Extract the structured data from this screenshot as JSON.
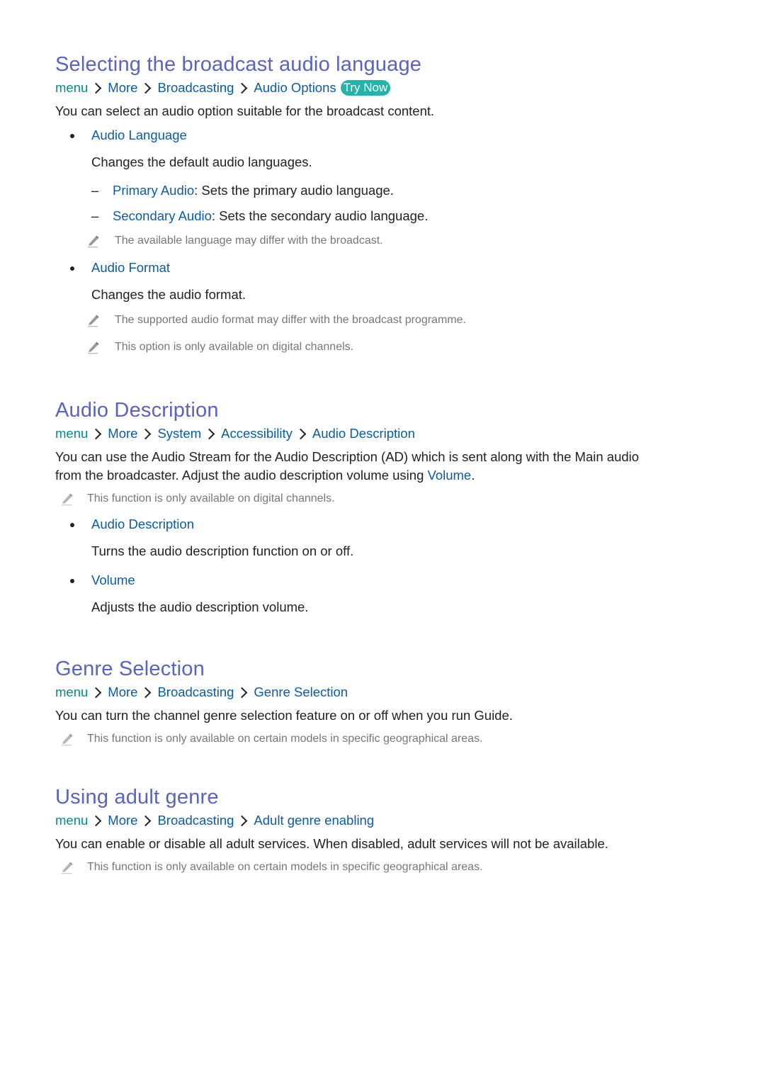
{
  "sections": [
    {
      "title": "Selecting the broadcast audio language",
      "breadcrumb": [
        "menu",
        "More",
        "Broadcasting",
        "Audio Options"
      ],
      "try_now_label": "Try Now",
      "intro": "You can select an audio option suitable for the broadcast content.",
      "items": [
        {
          "label": "Audio Language",
          "description": "Changes the default audio languages.",
          "subitems": [
            {
              "label": "Primary Audio",
              "text": ": Sets the primary audio language."
            },
            {
              "label": "Secondary Audio",
              "text": ": Sets the secondary audio language."
            }
          ],
          "notes": [
            "The available language may differ with the broadcast."
          ]
        },
        {
          "label": "Audio Format",
          "description": "Changes the audio format.",
          "notes": [
            "The supported audio format may differ with the broadcast programme.",
            "This option is only available on digital channels."
          ]
        }
      ]
    },
    {
      "title": "Audio Description",
      "breadcrumb": [
        "menu",
        "More",
        "System",
        "Accessibility",
        "Audio Description"
      ],
      "intro_line1": "You can use the Audio Stream for the Audio Description (AD) which is sent along with the Main audio",
      "intro_line2_prefix": "from the broadcaster. Adjust the audio description volume using ",
      "intro_link": "Volume",
      "intro_suffix": ".",
      "note": "This function is only available on digital channels.",
      "items": [
        {
          "label": "Audio Description",
          "description": "Turns the audio description function on or off."
        },
        {
          "label": "Volume",
          "description": "Adjusts the audio description volume."
        }
      ]
    },
    {
      "title": "Genre Selection",
      "breadcrumb": [
        "menu",
        "More",
        "Broadcasting",
        "Genre Selection"
      ],
      "intro": "You can turn the channel genre selection feature on or off when you run Guide.",
      "note": "This function is only available on certain models in specific geographical areas."
    },
    {
      "title": "Using adult genre",
      "breadcrumb": [
        "menu",
        "More",
        "Broadcasting",
        "Adult genre enabling"
      ],
      "intro": "You can enable or disable all adult services. When disabled, adult services will not be available.",
      "note": "This function is only available on certain models in specific geographical areas."
    }
  ],
  "colors": {
    "heading": "#5a62c2",
    "link": "#0a5ca8",
    "menu_word": "#098a8f",
    "try_now_bg": "#24b3a8",
    "note_text": "#777777"
  }
}
